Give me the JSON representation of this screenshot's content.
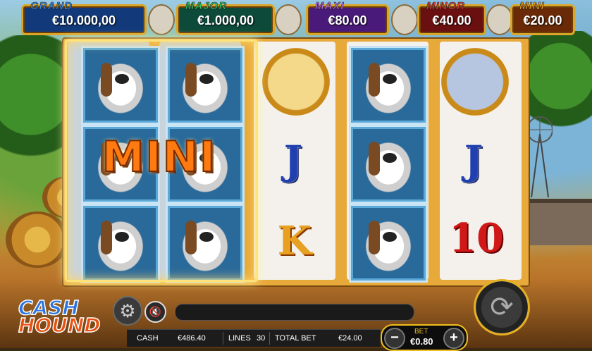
{
  "jackpots": [
    {
      "label": "GRAND",
      "value": "€10.000,00",
      "label_color": "#3a8ee8",
      "bg": "#123a7a"
    },
    {
      "label": "MAJOR",
      "value": "€1.000,00",
      "label_color": "#2ec86a",
      "bg": "#0d4a3a"
    },
    {
      "label": "MAXI",
      "value": "€80.00",
      "label_color": "#c070f0",
      "bg": "#4a1a7a"
    },
    {
      "label": "MINOR",
      "value": "€40.00",
      "label_color": "#e83a3a",
      "bg": "#6a1010"
    },
    {
      "label": "MINI",
      "value": "€20.00",
      "label_color": "#f0a020",
      "bg": "#6a2a08"
    }
  ],
  "reels": [
    [
      "dog",
      "dog",
      "dog"
    ],
    [
      "dog",
      "dog",
      "dog"
    ],
    [
      "rooster-coin",
      "J",
      "K"
    ],
    [
      "dog",
      "dog",
      "dog"
    ],
    [
      "donkey-coin",
      "J",
      "10"
    ]
  ],
  "win_banner": "MINI",
  "logo": {
    "line1": "CASH",
    "line2": "HOUND"
  },
  "status": {
    "cash_label": "CASH",
    "cash_value": "€486.40",
    "lines_label": "LINES",
    "lines_value": "30",
    "total_bet_label": "TOTAL BET",
    "total_bet_value": "€24.00"
  },
  "bet": {
    "label": "BET",
    "value": "€0.80",
    "minus": "−",
    "plus": "+"
  },
  "icons": {
    "settings": "gear-icon",
    "sound": "speaker-muted-icon",
    "spin": "spin-arrows-icon"
  },
  "colors": {
    "frame": "#e7a93a",
    "accent": "#f0c020"
  }
}
